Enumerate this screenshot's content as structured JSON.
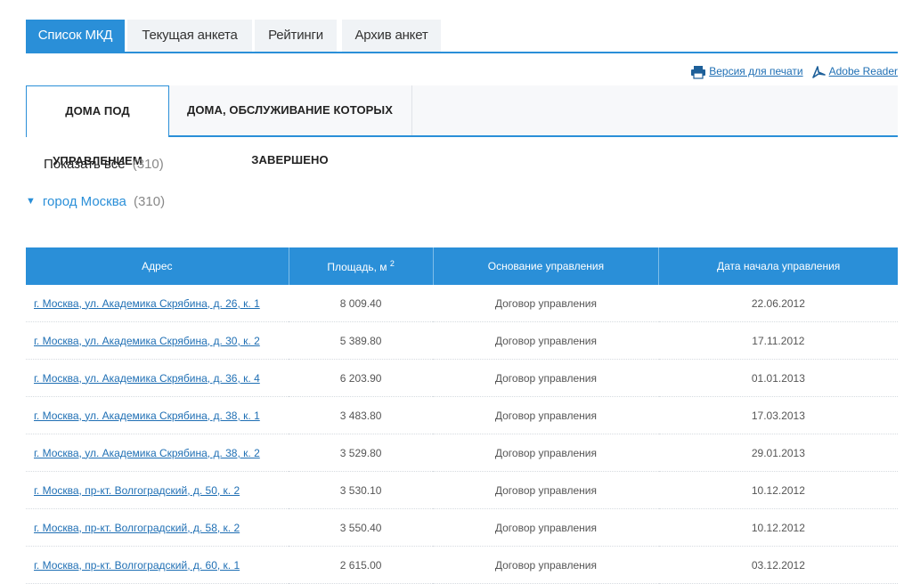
{
  "top_tabs": [
    "Список МКД",
    "Текущая анкета",
    "Рейтинги",
    "Архив анкет"
  ],
  "tools": {
    "print_label": "Версия для печати",
    "reader_label": "Adobe Reader"
  },
  "sub_tabs": [
    "ДОМА ПОД УПРАВЛЕНИЕМ",
    "ДОМА, ОБСЛУЖИВАНИЕ КОТОРЫХ ЗАВЕРШЕНО"
  ],
  "filter": {
    "show_all_label": "Показать все",
    "show_all_count": "(310)",
    "city_label": "город Москва",
    "city_count": "(310)"
  },
  "table": {
    "headers": {
      "address": "Адрес",
      "area": "Площадь, м",
      "area_sup": "2",
      "basis": "Основание управления",
      "date": "Дата начала управления"
    },
    "rows": [
      {
        "address": "г. Москва, ул. Академика Скрябина, д. 26, к. 1",
        "area": "8 009.40",
        "basis": "Договор управления",
        "date": "22.06.2012"
      },
      {
        "address": "г. Москва, ул. Академика Скрябина, д. 30, к. 2",
        "area": "5 389.80",
        "basis": "Договор управления",
        "date": "17.11.2012"
      },
      {
        "address": "г. Москва, ул. Академика Скрябина, д. 36, к. 4",
        "area": "6 203.90",
        "basis": "Договор управления",
        "date": "01.01.2013"
      },
      {
        "address": "г. Москва, ул. Академика Скрябина, д. 38, к. 1",
        "area": "3 483.80",
        "basis": "Договор управления",
        "date": "17.03.2013"
      },
      {
        "address": "г. Москва, ул. Академика Скрябина, д. 38, к. 2",
        "area": "3 529.80",
        "basis": "Договор управления",
        "date": "29.01.2013"
      },
      {
        "address": "г. Москва, пр-кт. Волгоградский, д. 50, к. 2",
        "area": "3 530.10",
        "basis": "Договор управления",
        "date": "10.12.2012"
      },
      {
        "address": "г. Москва, пр-кт. Волгоградский, д. 58, к. 2",
        "area": "3 550.40",
        "basis": "Договор управления",
        "date": "10.12.2012"
      },
      {
        "address": "г. Москва, пр-кт. Волгоградский, д. 60, к. 1",
        "area": "2 615.00",
        "basis": "Договор управления",
        "date": "03.12.2012"
      }
    ]
  },
  "colors": {
    "accent": "#2a8fd8",
    "link": "#1f6fb4"
  }
}
